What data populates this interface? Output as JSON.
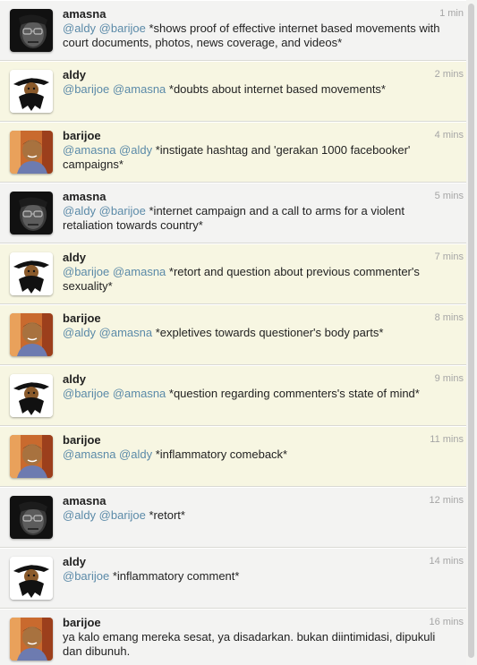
{
  "tweets": [
    {
      "user": "amasna",
      "time": "1 min",
      "mentions": "@aldy @barijoe",
      "body": " *shows proof of effective internet based movements with court documents, photos, news coverage, and videos*",
      "avatar": "amasna-avatar",
      "highlight": false
    },
    {
      "user": "aldy",
      "time": "2 mins",
      "mentions": "@barijoe @amasna",
      "body": " *doubts about internet based movements*",
      "avatar": "aldy-avatar",
      "highlight": true
    },
    {
      "user": "barijoe",
      "time": "4 mins",
      "mentions": "@amasna @aldy",
      "body": " *instigate hashtag and 'gerakan 1000 facebooker' campaigns*",
      "avatar": "barijoe-avatar",
      "highlight": true
    },
    {
      "user": "amasna",
      "time": "5 mins",
      "mentions": "@aldy @barijoe",
      "body": " *internet campaign and a call to arms for a violent retaliation towards country*",
      "avatar": "amasna-avatar",
      "highlight": false
    },
    {
      "user": "aldy",
      "time": "7 mins",
      "mentions": "@barijoe @amasna",
      "body": " *retort and question about previous commenter's sexuality*",
      "avatar": "aldy-avatar",
      "highlight": true
    },
    {
      "user": "barijoe",
      "time": "8 mins",
      "mentions": "@aldy @amasna",
      "body": " *expletives towards questioner's body parts*",
      "avatar": "barijoe-avatar",
      "highlight": true
    },
    {
      "user": "aldy",
      "time": "9 mins",
      "mentions": "@barijoe @amasna",
      "body": " *question regarding commenters's state of mind*",
      "avatar": "aldy-avatar",
      "highlight": true
    },
    {
      "user": "barijoe",
      "time": "11 mins",
      "mentions": "@amasna @aldy",
      "body": " *inflammatory comeback*",
      "avatar": "barijoe-avatar",
      "highlight": true
    },
    {
      "user": "amasna",
      "time": "12 mins",
      "mentions": "@aldy @barijoe",
      "body": " *retort*",
      "avatar": "amasna-avatar",
      "highlight": false
    },
    {
      "user": "aldy",
      "time": "14 mins",
      "mentions": "@barijoe",
      "body": " *inflammatory comment*",
      "avatar": "aldy-avatar",
      "highlight": false
    },
    {
      "user": "barijoe",
      "time": "16 mins",
      "mentions": "",
      "body": "ya kalo emang mereka sesat, ya disadarkan. bukan diintimidasi, dipukuli dan dibunuh.",
      "avatar": "barijoe-avatar",
      "highlight": false
    }
  ],
  "colors": {
    "mention_bg": "#f7f6e2",
    "normal_bg": "#f3f3f2",
    "link": "#5b8aa8",
    "time": "#a5a5a5"
  }
}
